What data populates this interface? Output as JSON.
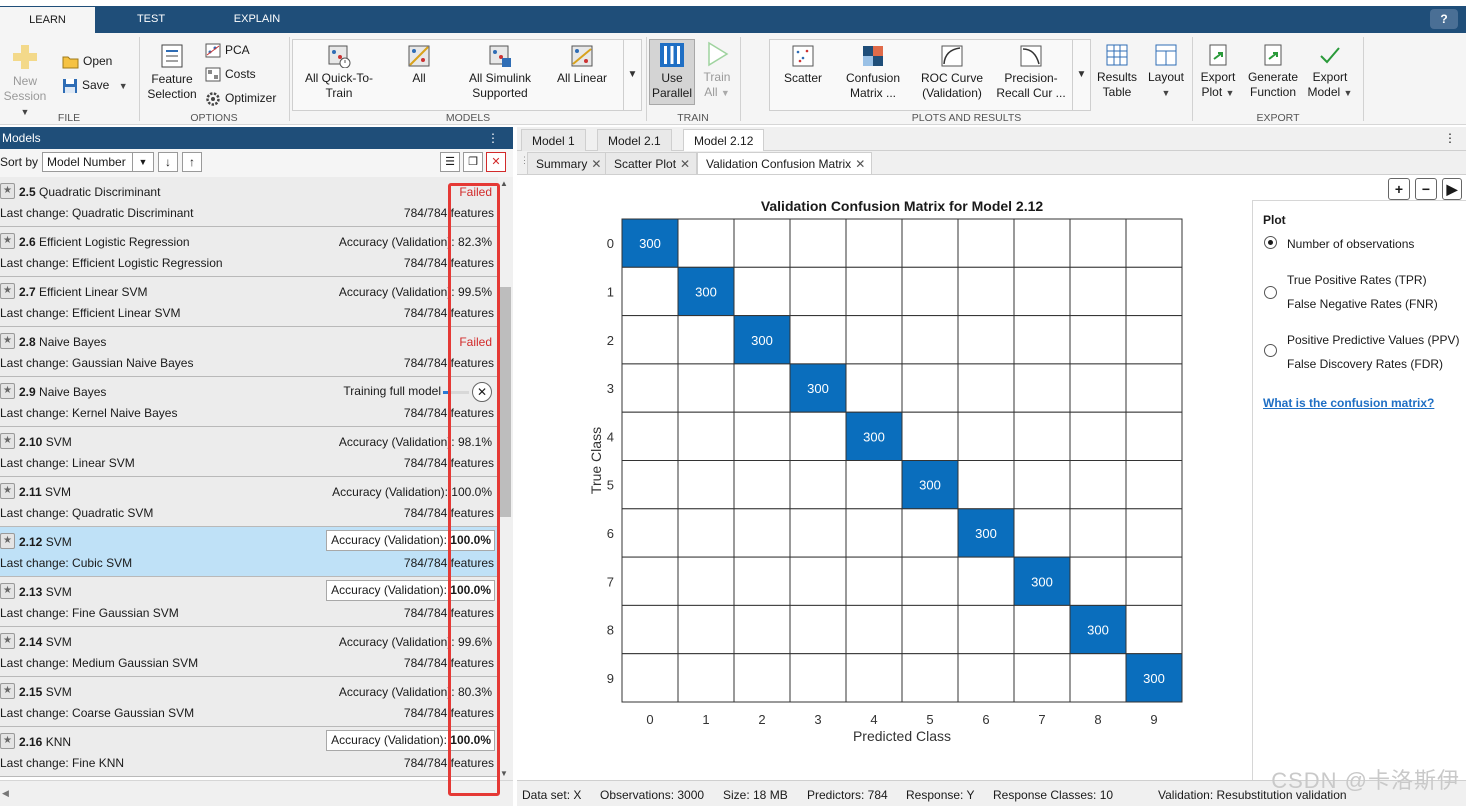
{
  "tabs": [
    "LEARN",
    "TEST",
    "EXPLAIN"
  ],
  "help_label": "?",
  "ribbon": {
    "file": {
      "label": "FILE",
      "new_session": "New",
      "new_session_2": "Session",
      "open": "Open",
      "save": "Save"
    },
    "options": {
      "label": "OPTIONS",
      "feature": "Feature",
      "selection": "Selection",
      "pca": "PCA",
      "costs": "Costs",
      "optimizer": "Optimizer"
    },
    "models": {
      "label": "MODELS",
      "items": [
        {
          "l1": "All Quick-To-",
          "l2": "Train"
        },
        {
          "l1": "All",
          "l2": ""
        },
        {
          "l1": "All Simulink",
          "l2": "Supported"
        },
        {
          "l1": "All Linear",
          "l2": ""
        }
      ]
    },
    "train": {
      "label": "TRAIN",
      "use": "Use",
      "parallel": "Parallel",
      "train": "Train",
      "all": "All"
    },
    "plots": {
      "label": "PLOTS AND RESULTS",
      "items": [
        {
          "l1": "Scatter",
          "l2": ""
        },
        {
          "l1": "Confusion",
          "l2": "Matrix ..."
        },
        {
          "l1": "ROC Curve",
          "l2": "(Validation)"
        },
        {
          "l1": "Precision-",
          "l2": "Recall Cur ..."
        }
      ],
      "results": "Results",
      "table": "Table",
      "layout": "Layout"
    },
    "export": {
      "label": "EXPORT",
      "items": [
        {
          "l1": "Export",
          "l2": "Plot"
        },
        {
          "l1": "Generate",
          "l2": "Function"
        },
        {
          "l1": "Export",
          "l2": "Model"
        }
      ]
    }
  },
  "models_panel": {
    "title": "Models",
    "menu": "⋮",
    "sort_label": "Sort by",
    "sort_value": "Model Number"
  },
  "models": [
    {
      "num": "2.5",
      "type": "Quadratic Discriminant",
      "status": "Failed",
      "status_kind": "failed",
      "change": "Last change: Quadratic Discriminant",
      "features": "784/784 features"
    },
    {
      "num": "2.6",
      "type": "Efficient Logistic Regression",
      "status": "Accuracy (Validation): 82.3%",
      "status_kind": "plain",
      "change": "Last change: Efficient Logistic Regression",
      "features": "784/784 features"
    },
    {
      "num": "2.7",
      "type": "Efficient Linear SVM",
      "status": "Accuracy (Validation): 99.5%",
      "status_kind": "plain",
      "change": "Last change: Efficient Linear SVM",
      "features": "784/784 features"
    },
    {
      "num": "2.8",
      "type": "Naive Bayes",
      "status": "Failed",
      "status_kind": "failed",
      "change": "Last change: Gaussian Naive Bayes",
      "features": "784/784 features"
    },
    {
      "num": "2.9",
      "type": "Naive Bayes",
      "status": "Training full model",
      "status_kind": "progress",
      "progress": 0.2,
      "change": "Last change: Kernel Naive Bayes",
      "features": "784/784 features"
    },
    {
      "num": "2.10",
      "type": "SVM",
      "status": "Accuracy (Validation): 98.1%",
      "status_kind": "plain",
      "change": "Last change: Linear SVM",
      "features": "784/784 features"
    },
    {
      "num": "2.11",
      "type": "SVM",
      "status": "Accuracy (Validation): 100.0%",
      "status_kind": "plain",
      "change": "Last change: Quadratic SVM",
      "features": "784/784 features"
    },
    {
      "num": "2.12",
      "type": "SVM",
      "status_prefix": "Accuracy (Validation): ",
      "status_value": "100.0%",
      "status_kind": "boxed",
      "selected": true,
      "change": "Last change: Cubic SVM",
      "features": "784/784 features"
    },
    {
      "num": "2.13",
      "type": "SVM",
      "status_prefix": "Accuracy (Validation): ",
      "status_value": "100.0%",
      "status_kind": "boxed",
      "change": "Last change: Fine Gaussian SVM",
      "features": "784/784 features"
    },
    {
      "num": "2.14",
      "type": "SVM",
      "status": "Accuracy (Validation): 99.6%",
      "status_kind": "plain",
      "change": "Last change: Medium Gaussian SVM",
      "features": "784/784 features"
    },
    {
      "num": "2.15",
      "type": "SVM",
      "status": "Accuracy (Validation): 80.3%",
      "status_kind": "plain",
      "change": "Last change: Coarse Gaussian SVM",
      "features": "784/784 features"
    },
    {
      "num": "2.16",
      "type": "KNN",
      "status_prefix": "Accuracy (Validation): ",
      "status_value": "100.0%",
      "status_kind": "boxed",
      "change": "Last change: Fine KNN",
      "features": "784/784 features"
    }
  ],
  "doc_tabs": [
    "Model 1",
    "Model 2.1",
    "Model 2.12"
  ],
  "doc_tab_active": 2,
  "sub_tabs": [
    "Summary",
    "Scatter Plot",
    "Validation Confusion Matrix"
  ],
  "sub_tab_active": 2,
  "zoom_buttons": [
    "+",
    "−",
    "▶"
  ],
  "chart_data": {
    "type": "heatmap",
    "title": "Validation Confusion Matrix for Model 2.12",
    "xlabel": "Predicted Class",
    "ylabel": "True Class",
    "x_classes": [
      "0",
      "1",
      "2",
      "3",
      "4",
      "5",
      "6",
      "7",
      "8",
      "9"
    ],
    "y_classes": [
      "0",
      "1",
      "2",
      "3",
      "4",
      "5",
      "6",
      "7",
      "8",
      "9"
    ],
    "matrix": [
      [
        300,
        0,
        0,
        0,
        0,
        0,
        0,
        0,
        0,
        0
      ],
      [
        0,
        300,
        0,
        0,
        0,
        0,
        0,
        0,
        0,
        0
      ],
      [
        0,
        0,
        300,
        0,
        0,
        0,
        0,
        0,
        0,
        0
      ],
      [
        0,
        0,
        0,
        300,
        0,
        0,
        0,
        0,
        0,
        0
      ],
      [
        0,
        0,
        0,
        0,
        300,
        0,
        0,
        0,
        0,
        0
      ],
      [
        0,
        0,
        0,
        0,
        0,
        300,
        0,
        0,
        0,
        0
      ],
      [
        0,
        0,
        0,
        0,
        0,
        0,
        300,
        0,
        0,
        0
      ],
      [
        0,
        0,
        0,
        0,
        0,
        0,
        0,
        300,
        0,
        0
      ],
      [
        0,
        0,
        0,
        0,
        0,
        0,
        0,
        0,
        300,
        0
      ],
      [
        0,
        0,
        0,
        0,
        0,
        0,
        0,
        0,
        0,
        300
      ]
    ],
    "cell_color": "#0a6ebd",
    "empty_color": "#ffffff"
  },
  "plot_options": {
    "title": "Plot",
    "options": [
      {
        "l1": "Number of observations",
        "l2": "",
        "selected": true
      },
      {
        "l1": "True Positive Rates (TPR)",
        "l2": "False Negative Rates (FNR)",
        "selected": false
      },
      {
        "l1": "Positive Predictive Values (PPV)",
        "l2": "False Discovery Rates (FDR)",
        "selected": false
      }
    ],
    "link": "What is the confusion matrix?"
  },
  "status_bar": {
    "dataset": "Data set: X",
    "observations": "Observations: 3000",
    "size": "Size: 18 MB",
    "predictors": "Predictors: 784",
    "response": "Response: Y",
    "classes": "Response Classes: 10",
    "validation": "Validation: Resubstitution validation"
  },
  "watermark": "CSDN @卡洛斯伊"
}
